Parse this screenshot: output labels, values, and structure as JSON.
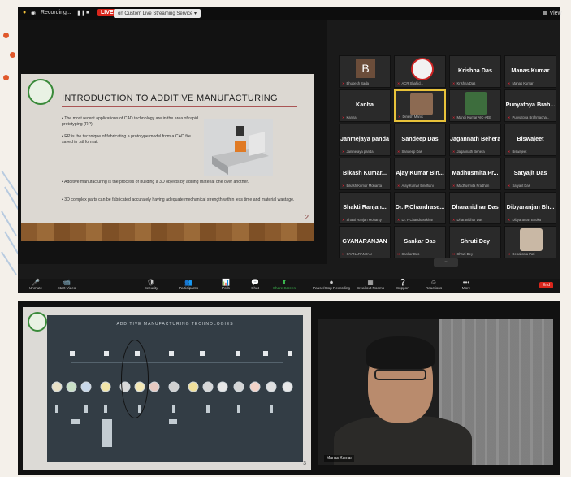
{
  "titlebar": {
    "recording": "Recording...",
    "live": "LIVE",
    "stream_service": "on Custom Live Streaming Service",
    "view": "View"
  },
  "slide1": {
    "title": "INTRODUCTION TO ADDITIVE MANUFACTURING",
    "bullets": [
      "The most recent applications of CAD technology are in the area of rapid prototyping (RP).",
      "RP is the technique of fabricating a prototype model from a CAD file saved in .stl format.",
      "Additive manufacturing is the process of building a 3D objects by adding material one over another.",
      "3D complex parts can be fabricated accurately having adequate mechanical strength within less time and material wastage."
    ],
    "page": "2"
  },
  "participants": [
    {
      "name": "B",
      "sub": "Bhupesh Sada"
    },
    {
      "name": "",
      "sub": "ACR Shahid..."
    },
    {
      "name": "Krishna Das",
      "sub": "Krishna Das"
    },
    {
      "name": "Manas Kumar",
      "sub": "Manas Kumar"
    },
    {
      "name": "Kanha",
      "sub": "Kanha"
    },
    {
      "name": "",
      "sub": "Dinesh Manik"
    },
    {
      "name": "",
      "sub": "Manoj Kumar AIC-AEE"
    },
    {
      "name": "Punyatoya Brah...",
      "sub": "Punyatoya Brahmacha..."
    },
    {
      "name": "Janmejaya panda",
      "sub": "Janmejaya panda"
    },
    {
      "name": "Sandeep Das",
      "sub": "Sandeep Das"
    },
    {
      "name": "Jagannath Behera",
      "sub": "Jagannath Behera"
    },
    {
      "name": "Biswajeet",
      "sub": "Biswajeet"
    },
    {
      "name": "Bikash Kumar...",
      "sub": "Bikash Kumar Mohanta"
    },
    {
      "name": "Ajay Kumar Bin...",
      "sub": "Ajay Kumar Bindhani"
    },
    {
      "name": "Madhusmita Pr...",
      "sub": "Madhusmita Pradhan"
    },
    {
      "name": "Satyajit Das",
      "sub": "Satyajit Das"
    },
    {
      "name": "Shakti Ranjan...",
      "sub": "Shakti Ranjan Mohanty"
    },
    {
      "name": "Dr. P.Chandrase...",
      "sub": "Dr. P.Chandrasekhar"
    },
    {
      "name": "Dharanidhar Das",
      "sub": "Dharanidhar Das"
    },
    {
      "name": "Dibyaranjan Bh...",
      "sub": "Dibyaranjan Bhoka"
    },
    {
      "name": "GYANARANJAN",
      "sub": "GYANARANJAN"
    },
    {
      "name": "Sankar Das",
      "sub": "Sankar Das"
    },
    {
      "name": "Shruti Dey",
      "sub": "Shruti Dey"
    },
    {
      "name": "",
      "sub": "Debabrata Pati"
    }
  ],
  "controls": [
    {
      "icon": "🎤",
      "label": "Unmute"
    },
    {
      "icon": "📹",
      "label": "Start Video"
    },
    {
      "icon": "🛡",
      "label": "Security"
    },
    {
      "icon": "👥",
      "label": "Participants"
    },
    {
      "icon": "📊",
      "label": "Polls"
    },
    {
      "icon": "💬",
      "label": "Chat"
    },
    {
      "icon": "⬆",
      "label": "Share Screen"
    },
    {
      "icon": "⏺",
      "label": "Pause/Stop Recording"
    },
    {
      "icon": "▦",
      "label": "Breakout Rooms"
    },
    {
      "icon": "❔",
      "label": "Support"
    },
    {
      "icon": "☺",
      "label": "Reactions"
    },
    {
      "icon": "•••",
      "label": "More"
    }
  ],
  "end_label": "End",
  "slide2": {
    "title": "ADDITIVE MANUFACTURING TECHNOLOGIES",
    "page": "3"
  },
  "speaker_name": "Manas Kumar",
  "colors": {
    "accent_live": "#d9261c",
    "active_speaker": "#e8c23a"
  }
}
